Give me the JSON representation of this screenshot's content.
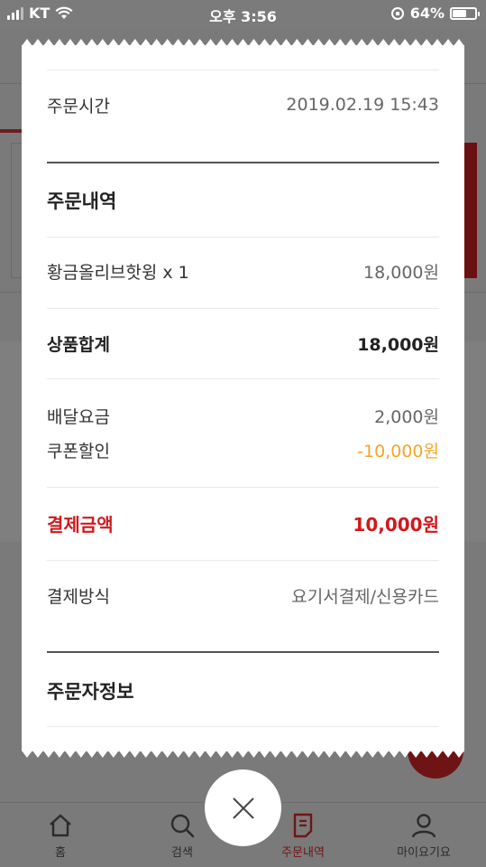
{
  "status_bar": {
    "carrier": "KT",
    "time": "오후 3:56",
    "battery": "64%",
    "battery_level": 0.64
  },
  "receipt": {
    "order_time": {
      "label": "주문시간",
      "value": "2019.02.19 15:43"
    },
    "order_details": {
      "title": "주문내역",
      "items": [
        {
          "name": "황금올리브핫윙 x 1",
          "price": "18,000원"
        }
      ],
      "subtotal": {
        "label": "상품합계",
        "value": "18,000원"
      }
    },
    "delivery_fee": {
      "label": "배달요금",
      "value": "2,000원"
    },
    "coupon_discount": {
      "label": "쿠폰할인",
      "value": "-10,000원"
    },
    "payment_total": {
      "label": "결제금액",
      "value": "10,000원"
    },
    "payment_method": {
      "label": "결제방식",
      "value": "요기서결제/신용카드"
    },
    "orderer_info": {
      "title": "주문자정보"
    }
  },
  "bottom_nav": {
    "items": [
      {
        "label": "홈",
        "icon": "home-icon"
      },
      {
        "label": "검색",
        "icon": "search-icon"
      },
      {
        "label": "주문내역",
        "icon": "order-history-icon",
        "active": true
      },
      {
        "label": "마이요기요",
        "icon": "profile-icon"
      }
    ]
  },
  "close_button": {
    "icon": "close-icon"
  },
  "colors": {
    "accent_red": "#d0191c",
    "discount_orange": "#f5a623",
    "overlay": "#7a7a7a"
  }
}
